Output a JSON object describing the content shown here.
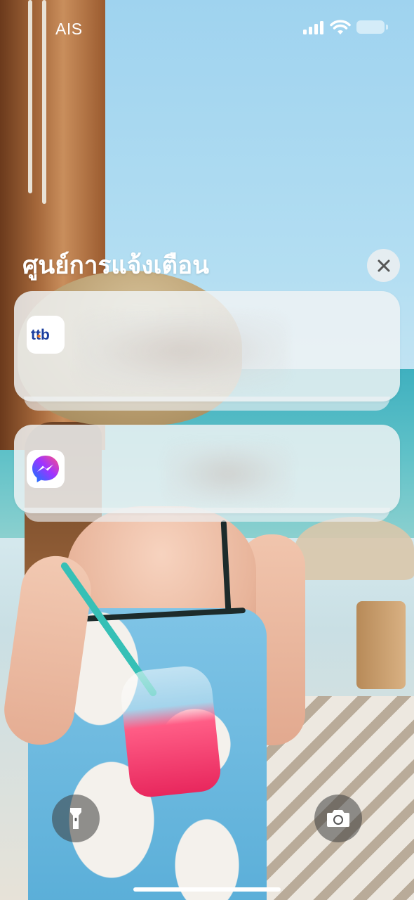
{
  "status_bar": {
    "carrier": "AIS",
    "signal_icon": "cellular-signal-icon",
    "wifi_icon": "wifi-icon",
    "battery_icon": "battery-icon"
  },
  "notification_center": {
    "title": "ศูนย์การแจ้งเตือน",
    "close_icon": "close-icon"
  },
  "notifications": [
    {
      "app_icon": "ttb-app-icon",
      "logo_text": "ttb",
      "content": ""
    },
    {
      "app_icon": "messenger-app-icon",
      "content": ""
    }
  ],
  "bottom_controls": {
    "flashlight_icon": "flashlight-icon",
    "camera_icon": "camera-icon"
  },
  "colors": {
    "ttb_blue": "#1a3d9e",
    "ttb_orange": "#f47b20",
    "messenger_gradient": [
      "#0a7cff",
      "#a033ff",
      "#ff5280"
    ]
  }
}
